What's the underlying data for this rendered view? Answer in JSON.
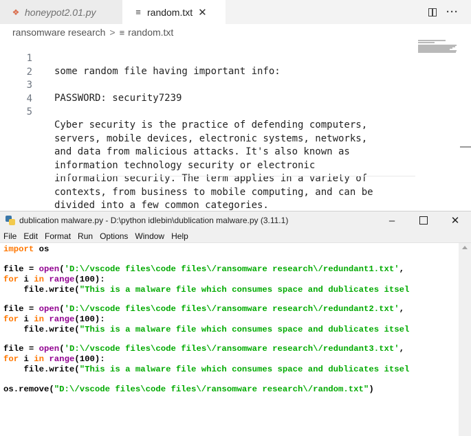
{
  "vscode": {
    "tabs": [
      {
        "label": "honeypot2.01.py",
        "icon": "python-file-icon",
        "icon_color": "#d96b4a",
        "active": false
      },
      {
        "label": "random.txt",
        "icon": "text-file-icon",
        "active": true
      }
    ],
    "tab_actions": {
      "split": "split-editor-icon",
      "more": "more-actions-icon",
      "more_glyph": "···"
    },
    "breadcrumb": {
      "folder": "ransomware research",
      "separator": ">",
      "file": "random.txt"
    },
    "lines": [
      {
        "num": "1",
        "text": "some random file having important info:"
      },
      {
        "num": "2",
        "text": ""
      },
      {
        "num": "3",
        "text": "PASSWORD: security7239"
      },
      {
        "num": "4",
        "text": ""
      },
      {
        "num": "5",
        "text": "Cyber security is the practice of defending computers,"
      },
      {
        "num": "",
        "text": "servers, mobile devices, electronic systems, networks,"
      },
      {
        "num": "",
        "text": "and data from malicious attacks. It's also known as"
      },
      {
        "num": "",
        "text": "information technology security or electronic"
      },
      {
        "num": "",
        "text": "information security. The term applies in a variety of"
      },
      {
        "num": "",
        "text": "contexts, from business to mobile computing, and can be"
      },
      {
        "num": "",
        "text": "divided into a few common categories."
      }
    ]
  },
  "idle": {
    "title": "dublication malware.py - D:\\python idlebin\\dublication malware.py (3.11.1)",
    "window_controls": {
      "minimize": "–",
      "close": "✕"
    },
    "menu": [
      "File",
      "Edit",
      "Format",
      "Run",
      "Options",
      "Window",
      "Help"
    ],
    "colors": {
      "keyword": "#ff7700",
      "builtin": "#900090",
      "string": "#00aa00"
    },
    "code": {
      "import_kw": "import",
      "import_mod": " os",
      "blocks": [
        {
          "file_assign": "file = ",
          "open_fn": "open",
          "open_paren": "(",
          "path": "'D:\\/vscode files\\code files\\/ransomware research\\/redundant1.txt'",
          "open_close": ",",
          "for_kw": "for",
          "for_var": " i ",
          "in_kw": "in",
          "range_fn": " range",
          "range_args": "(100):",
          "write_call": "    file.write(",
          "write_str": "\"This is a malware file which consumes space and dublicates itsel"
        },
        {
          "file_assign": "file = ",
          "open_fn": "open",
          "open_paren": "(",
          "path": "'D:\\/vscode files\\code files\\/ransomware research\\/redundant2.txt'",
          "open_close": ",",
          "for_kw": "for",
          "for_var": " i ",
          "in_kw": "in",
          "range_fn": " range",
          "range_args": "(100):",
          "write_call": "    file.write(",
          "write_str": "\"This is a malware file which consumes space and dublicates itsel"
        },
        {
          "file_assign": "file = ",
          "open_fn": "open",
          "open_paren": "(",
          "path": "'D:\\/vscode files\\code files\\/ransomware research\\/redundant3.txt'",
          "open_close": ",",
          "for_kw": "for",
          "for_var": " i ",
          "in_kw": "in",
          "range_fn": " range",
          "range_args": "(100):",
          "write_call": "    file.write(",
          "write_str": "\"This is a malware file which consumes space and dublicates itsel"
        }
      ],
      "remove_call": "os.remove(",
      "remove_str": "\"D:\\/vscode files\\code files\\/ransomware research\\/random.txt\"",
      "remove_close": ")"
    }
  }
}
